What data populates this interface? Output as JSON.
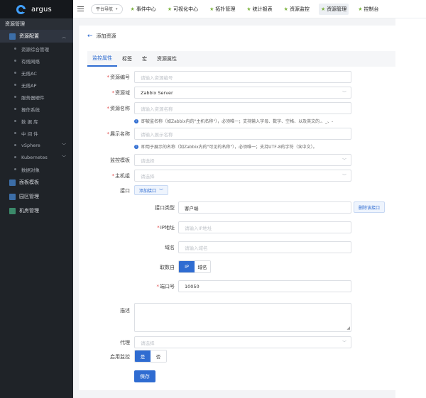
{
  "app": {
    "name": "argus"
  },
  "topnav": {
    "quick_nav": "平台导航",
    "items": [
      {
        "label": "事件中心"
      },
      {
        "label": "可视化中心"
      },
      {
        "label": "拓扑管理"
      },
      {
        "label": "统计报表"
      },
      {
        "label": "资源监控"
      },
      {
        "label": "资源管理"
      },
      {
        "label": "控制台"
      }
    ]
  },
  "sidebar": {
    "section_title": "资源管理",
    "group": "资源配置",
    "items": [
      {
        "label": "资源综合管理"
      },
      {
        "label": "有线网络"
      },
      {
        "label": "无线AC"
      },
      {
        "label": "无线AP"
      },
      {
        "label": "服务器硬件"
      },
      {
        "label": "操作系统"
      },
      {
        "label": "数 据 库"
      },
      {
        "label": "中 间 件"
      },
      {
        "label": "vSphere"
      },
      {
        "label": "Kubernetes"
      },
      {
        "label": "数据对象"
      }
    ],
    "bottom": [
      {
        "label": "面板模板"
      },
      {
        "label": "园区管理"
      },
      {
        "label": "机房管理"
      }
    ]
  },
  "page": {
    "back_label": "添加资源",
    "tabs": [
      "监控属性",
      "标签",
      "宏",
      "资源属性"
    ]
  },
  "form": {
    "resource_id": {
      "label": "资源编号",
      "placeholder": "请输入资源编号"
    },
    "resource_domain": {
      "label": "资源域",
      "value": "Zabbix Server"
    },
    "resource_name": {
      "label": "资源名称",
      "placeholder": "请输入资源名称",
      "hint": "即被监名称（如Zabbix内的\"主机名称\"），必须唯一；支持输入字母、数字、空格、以及英文的.、_、-"
    },
    "display_name": {
      "label": "展示名称",
      "placeholder": "请输入展示名称",
      "hint": "即用于展示的名称（如Zabbix内的\"可见的名称\"），必须唯一；支持UTF-8的字符（含中文）。"
    },
    "template": {
      "label": "监控模板",
      "placeholder": "请选择"
    },
    "host_group": {
      "label": "主机组",
      "placeholder": "请选择"
    },
    "interface": {
      "label": "接口",
      "add_button": "添加接口"
    },
    "interface_type": {
      "label": "接口类型",
      "value": "客户端",
      "remove_button": "删除该接口"
    },
    "ip": {
      "label": "IP地址",
      "placeholder": "请输入IP地址"
    },
    "dns": {
      "label": "域名",
      "placeholder": "请输入域名"
    },
    "connect_via": {
      "label": "取数自",
      "options": [
        "IP",
        "域名"
      ],
      "selected": "IP"
    },
    "port": {
      "label": "端口号",
      "value": "10050"
    },
    "description": {
      "label": "描述"
    },
    "proxy": {
      "label": "代理",
      "placeholder": "请选择"
    },
    "enable_monitor": {
      "label": "启用监控",
      "options": [
        "是",
        "否"
      ],
      "selected": "是"
    },
    "save_label": "保存"
  }
}
